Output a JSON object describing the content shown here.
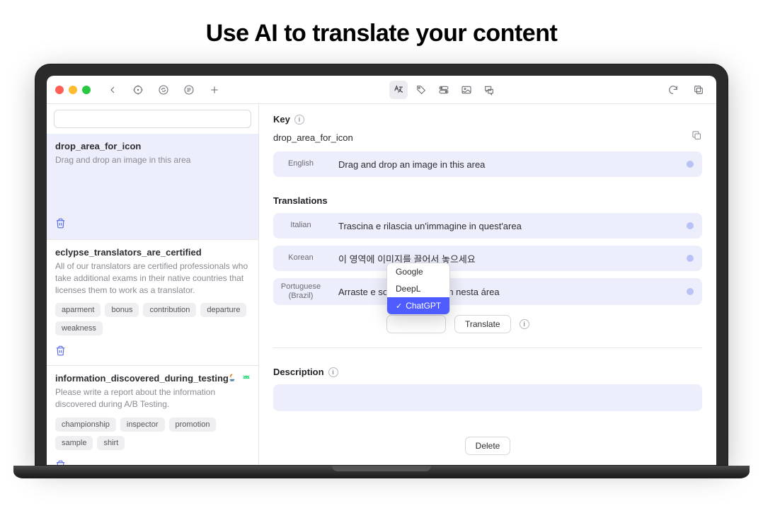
{
  "hero": {
    "title": "Use AI to translate your content"
  },
  "toolbar": {
    "icons": [
      "back",
      "target",
      "sync",
      "list",
      "plus"
    ],
    "center": [
      "translate",
      "tag",
      "toggle",
      "image",
      "chat"
    ],
    "right": [
      "refresh",
      "copy"
    ]
  },
  "search": {
    "placeholder": ""
  },
  "cards": [
    {
      "key": "drop_area_for_icon",
      "desc": "Drag and drop an image in this area",
      "tags": [],
      "selected": true
    },
    {
      "key": "eclypse_translators_are_certified",
      "desc": "All of our translators are certified professionals who take additional exams in their native countries that licenses them to work as a translator.",
      "tags": [
        "aparment",
        "bonus",
        "contribution",
        "departure",
        "weakness"
      ],
      "selected": false
    },
    {
      "key": "information_discovered_during_testing",
      "desc": "Please write a report about the information discovered during A/B Testing.",
      "tags": [
        "championship",
        "inspector",
        "promotion",
        "sample",
        "shirt"
      ],
      "selected": false,
      "platforms": [
        "java",
        "android"
      ]
    }
  ],
  "detail": {
    "key_label": "Key",
    "key_value": "drop_area_for_icon",
    "source": {
      "lang": "English",
      "text": "Drag and drop an image in this area"
    },
    "translations_label": "Translations",
    "translations": [
      {
        "lang": "Italian",
        "text": "Trascina e rilascia un'immagine in quest'area"
      },
      {
        "lang": "Korean",
        "text": "이 영역에 이미지를 끌어서 놓으세요"
      },
      {
        "lang": "Portuguese (Brazil)",
        "text": "Arraste e solte uma imagem nesta área"
      }
    ],
    "providers": {
      "options": [
        "Google",
        "DeepL",
        "ChatGPT"
      ],
      "selected": "ChatGPT"
    },
    "translate_button": "Translate",
    "description_label": "Description",
    "delete_button": "Delete"
  }
}
